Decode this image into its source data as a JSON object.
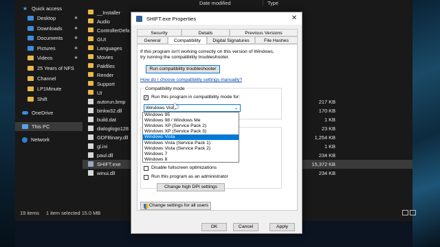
{
  "explorer": {
    "nav": [
      {
        "label": "Quick access",
        "icon": "star-icon"
      },
      {
        "label": "Desktop",
        "icon": "desktop-icon",
        "pinned": true
      },
      {
        "label": "Downloads",
        "icon": "download-icon",
        "pinned": true
      },
      {
        "label": "Documents",
        "icon": "documents-icon",
        "pinned": true
      },
      {
        "label": "Pictures",
        "icon": "pictures-icon",
        "pinned": true
      },
      {
        "label": "Videos",
        "icon": "folder-icon",
        "pinned": true
      },
      {
        "label": "25 Years of NFS",
        "icon": "folder-icon"
      },
      {
        "label": "Channel",
        "icon": "folder-icon"
      },
      {
        "label": "LP1Minute",
        "icon": "folder-icon"
      },
      {
        "label": "Shift",
        "icon": "folder-icon"
      },
      {
        "label": "OneDrive",
        "icon": "cloud-icon"
      },
      {
        "label": "This PC",
        "icon": "pc-icon"
      },
      {
        "label": "Network",
        "icon": "network-icon"
      }
    ],
    "columns": {
      "date": "Date modified",
      "type": "Type"
    },
    "files": [
      {
        "name": "__Installer",
        "kind": "folder",
        "size": ""
      },
      {
        "name": "Audio",
        "kind": "folder",
        "size": ""
      },
      {
        "name": "ControllerDefa",
        "kind": "folder",
        "size": ""
      },
      {
        "name": "GUI",
        "kind": "folder",
        "size": ""
      },
      {
        "name": "Languages",
        "kind": "folder",
        "size": ""
      },
      {
        "name": "Movies",
        "kind": "folder",
        "size": ""
      },
      {
        "name": "Pakfiles",
        "kind": "folder",
        "size": ""
      },
      {
        "name": "Render",
        "kind": "folder",
        "size": ""
      },
      {
        "name": "Support",
        "kind": "folder",
        "size": ""
      },
      {
        "name": "UI",
        "kind": "folder",
        "size": ""
      },
      {
        "name": "autorun.bmp",
        "kind": "doc",
        "size": "217 KB"
      },
      {
        "name": "binkw32.dll",
        "kind": "doc",
        "size": "170 KB"
      },
      {
        "name": "build.dat",
        "kind": "doc",
        "size": "1 KB"
      },
      {
        "name": "dialoglogo128",
        "kind": "doc",
        "size": "23 KB"
      },
      {
        "name": "GDFBinary.dll",
        "kind": "doc",
        "size": "1,254 KB"
      },
      {
        "name": "gl.ini",
        "kind": "doc",
        "size": "1 KB"
      },
      {
        "name": "paul.dll",
        "kind": "doc",
        "size": "234 KB"
      },
      {
        "name": "SHIFT.exe",
        "kind": "exe",
        "size": "15,372 KB",
        "selected": true
      },
      {
        "name": "winui.dll",
        "kind": "doc",
        "size": "234 KB"
      }
    ],
    "status": {
      "count": "19 items",
      "selection": "1 item selected  15.0 MB"
    }
  },
  "dialog": {
    "title": "SHIFT.exe Properties",
    "tabs_top": [
      "Security",
      "Details",
      "Previous Versions"
    ],
    "tabs_bottom": [
      "General",
      "Compatibility",
      "Digital Signatures",
      "File Hashes"
    ],
    "intro": [
      "If this program isn't working correctly on this version of Windows,",
      "try running the compatibility troubleshooter."
    ],
    "run_troubleshooter": "Run compatibility troubleshooter",
    "manual_link": "How do I choose compatibility settings manually?",
    "compat_group": "Compatibility mode",
    "compat_checkbox": "Run this program in compatibility mode for:",
    "compat_selected": "Windows Vista",
    "compat_options": [
      "Windows 95",
      "Windows 98 / Windows Me",
      "Windows XP (Service Pack 2)",
      "Windows XP (Service Pack 3)",
      "Windows Vista",
      "Windows Vista (Service Pack 1)",
      "Windows Vista (Service Pack 2)",
      "Windows 7",
      "Windows 8"
    ],
    "disable_fullscreen": "Disable fullscreen optimizations",
    "run_admin": "Run this program as an administrator",
    "change_dpi": "Change high DPI settings",
    "change_all_users": "Change settings for all users",
    "ok": "OK",
    "cancel": "Cancel",
    "apply": "Apply"
  }
}
